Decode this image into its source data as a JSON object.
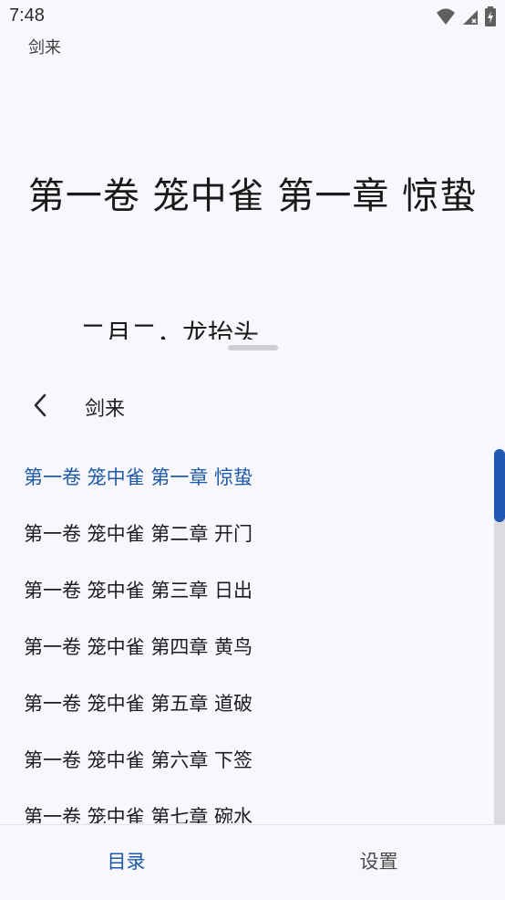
{
  "status_bar": {
    "time": "7:48",
    "icons": [
      "wifi-icon",
      "signal-icon",
      "battery-charging-icon"
    ]
  },
  "reader": {
    "book_name": "剑来",
    "chapter_heading": "第一卷 笼中雀 第一章 惊蛰",
    "partial_text": "二月二，龙抬头"
  },
  "sheet": {
    "back_icon": "chevron-left-icon",
    "title": "剑来",
    "chapters": [
      {
        "label": "第一卷 笼中雀 第一章 惊蛰",
        "active": true
      },
      {
        "label": "第一卷 笼中雀 第二章 开门",
        "active": false
      },
      {
        "label": "第一卷 笼中雀 第三章 日出",
        "active": false
      },
      {
        "label": "第一卷 笼中雀 第四章 黄鸟",
        "active": false
      },
      {
        "label": "第一卷 笼中雀 第五章 道破",
        "active": false
      },
      {
        "label": "第一卷 笼中雀 第六章 下签",
        "active": false
      },
      {
        "label": "第一卷 笼中雀 第七章 碗水",
        "active": false
      }
    ],
    "scroll_position": 0.0
  },
  "bottom_nav": {
    "tabs": [
      {
        "label": "目录",
        "active": true
      },
      {
        "label": "设置",
        "active": false
      }
    ]
  },
  "colors": {
    "accent": "#1e5aa8",
    "background": "#f8f7fc",
    "scroll_thumb": "#1f57b5"
  }
}
